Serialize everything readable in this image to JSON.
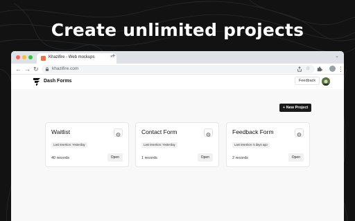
{
  "headline": "Create unlimited projects",
  "browser": {
    "tab_title": "Khazifire - Web mockups",
    "tab_close": "×",
    "new_tab": "+",
    "tab_menu": "⌄",
    "url": "khazifire.com",
    "nav_back": "←",
    "nav_forward": "→",
    "reload": "↻",
    "more": "⋮"
  },
  "app": {
    "name": "Dash Forms",
    "feedback_label": "Feedback",
    "new_project_label": "+ New Project"
  },
  "projects": [
    {
      "title": "Waitlist",
      "last_insertion": "Last insertion: Yesterday",
      "records": "40 records",
      "open": "Open"
    },
    {
      "title": "Contact Form",
      "last_insertion": "Last insertion: Yesterday",
      "records": "1 records",
      "open": "Open"
    },
    {
      "title": "Feedback Form",
      "last_insertion": "Last insertion: 5 days ago",
      "records": "2 records",
      "open": "Open"
    }
  ]
}
